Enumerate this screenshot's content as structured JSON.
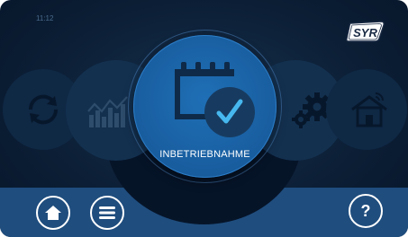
{
  "status": {
    "time": "11:12"
  },
  "brand": {
    "logo_text": "SYR"
  },
  "carousel": {
    "active_label": "INBETRIEBNAHME",
    "items": [
      {
        "icon": "sync-icon"
      },
      {
        "icon": "chart-icon"
      },
      {
        "icon": "calendar-check-icon"
      },
      {
        "icon": "gears-icon"
      },
      {
        "icon": "house-wifi-icon"
      }
    ]
  },
  "nav": {
    "home_icon": "home-icon",
    "menu_icon": "menu-icon",
    "help_label": "?"
  },
  "colors": {
    "bg": "#0c1f36",
    "accent": "#1c67ad",
    "bar": "#1f4d7e",
    "check_circle": "#173b60",
    "check": "#47b8ef"
  }
}
